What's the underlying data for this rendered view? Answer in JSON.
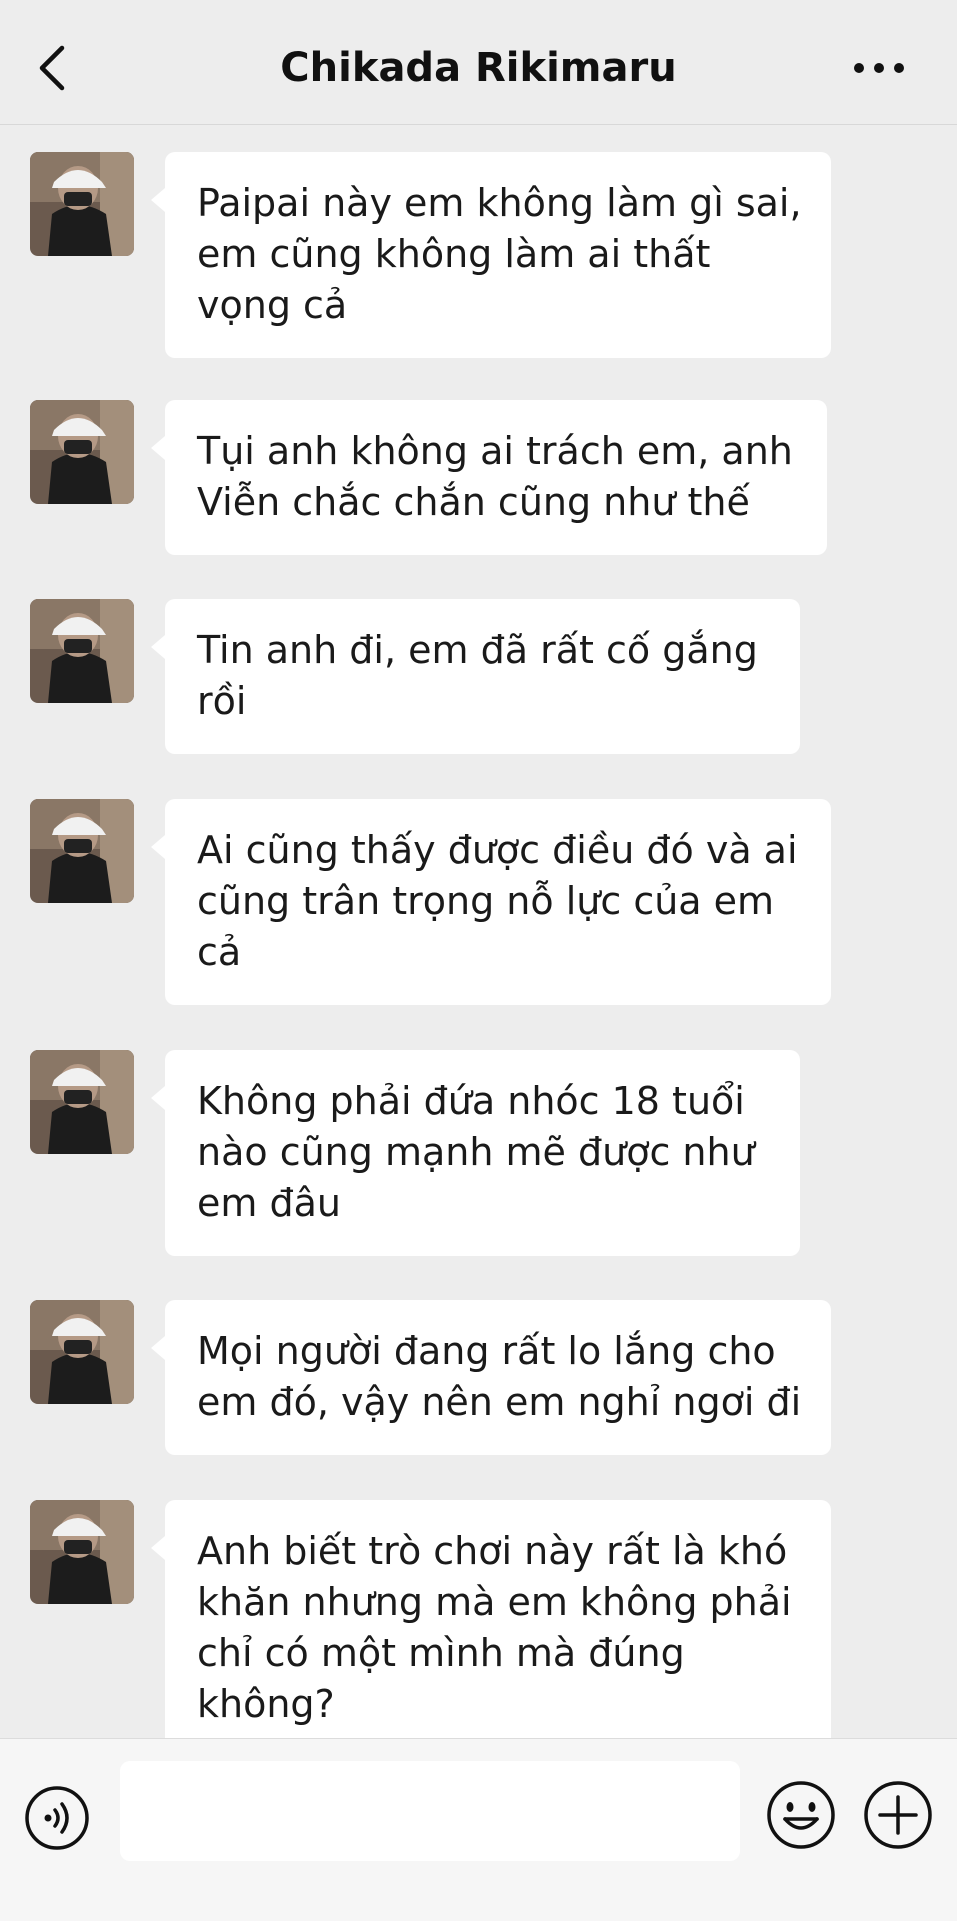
{
  "header": {
    "title": "Chikada Rikimaru",
    "back_icon": "chevron-left-icon",
    "more_icon": "more-horizontal-icon"
  },
  "messages": [
    {
      "text": "Paipai này em không làm gì sai,\nem cũng không làm ai thất\nvọng cả"
    },
    {
      "text": "Tụi anh không ai trách em, anh\nViễn chắc chắn cũng như thế"
    },
    {
      "text": "Tin anh đi, em đã rất cố gắng\nrồi"
    },
    {
      "text": "Ai cũng thấy được điều đó và ai\ncũng trân trọng nỗ lực của em\ncả"
    },
    {
      "text": "Không phải đứa nhóc 18 tuổi\nnào cũng mạnh mẽ được như\nem đâu"
    },
    {
      "text": "Mọi người đang rất lo lắng cho\nem đó, vậy nên em nghỉ ngơi đi"
    },
    {
      "text": "Anh biết trò chơi này rất là khó\nkhăn nhưng mà em không phải\nchỉ có một mình mà đúng\nkhông?"
    }
  ],
  "input_bar": {
    "voice_icon": "voice-icon",
    "input_value": "",
    "emoji_icon": "emoji-icon",
    "plus_icon": "plus-icon"
  },
  "colors": {
    "background": "#ededed",
    "bubble": "#ffffff",
    "text": "#1a1a1a"
  }
}
